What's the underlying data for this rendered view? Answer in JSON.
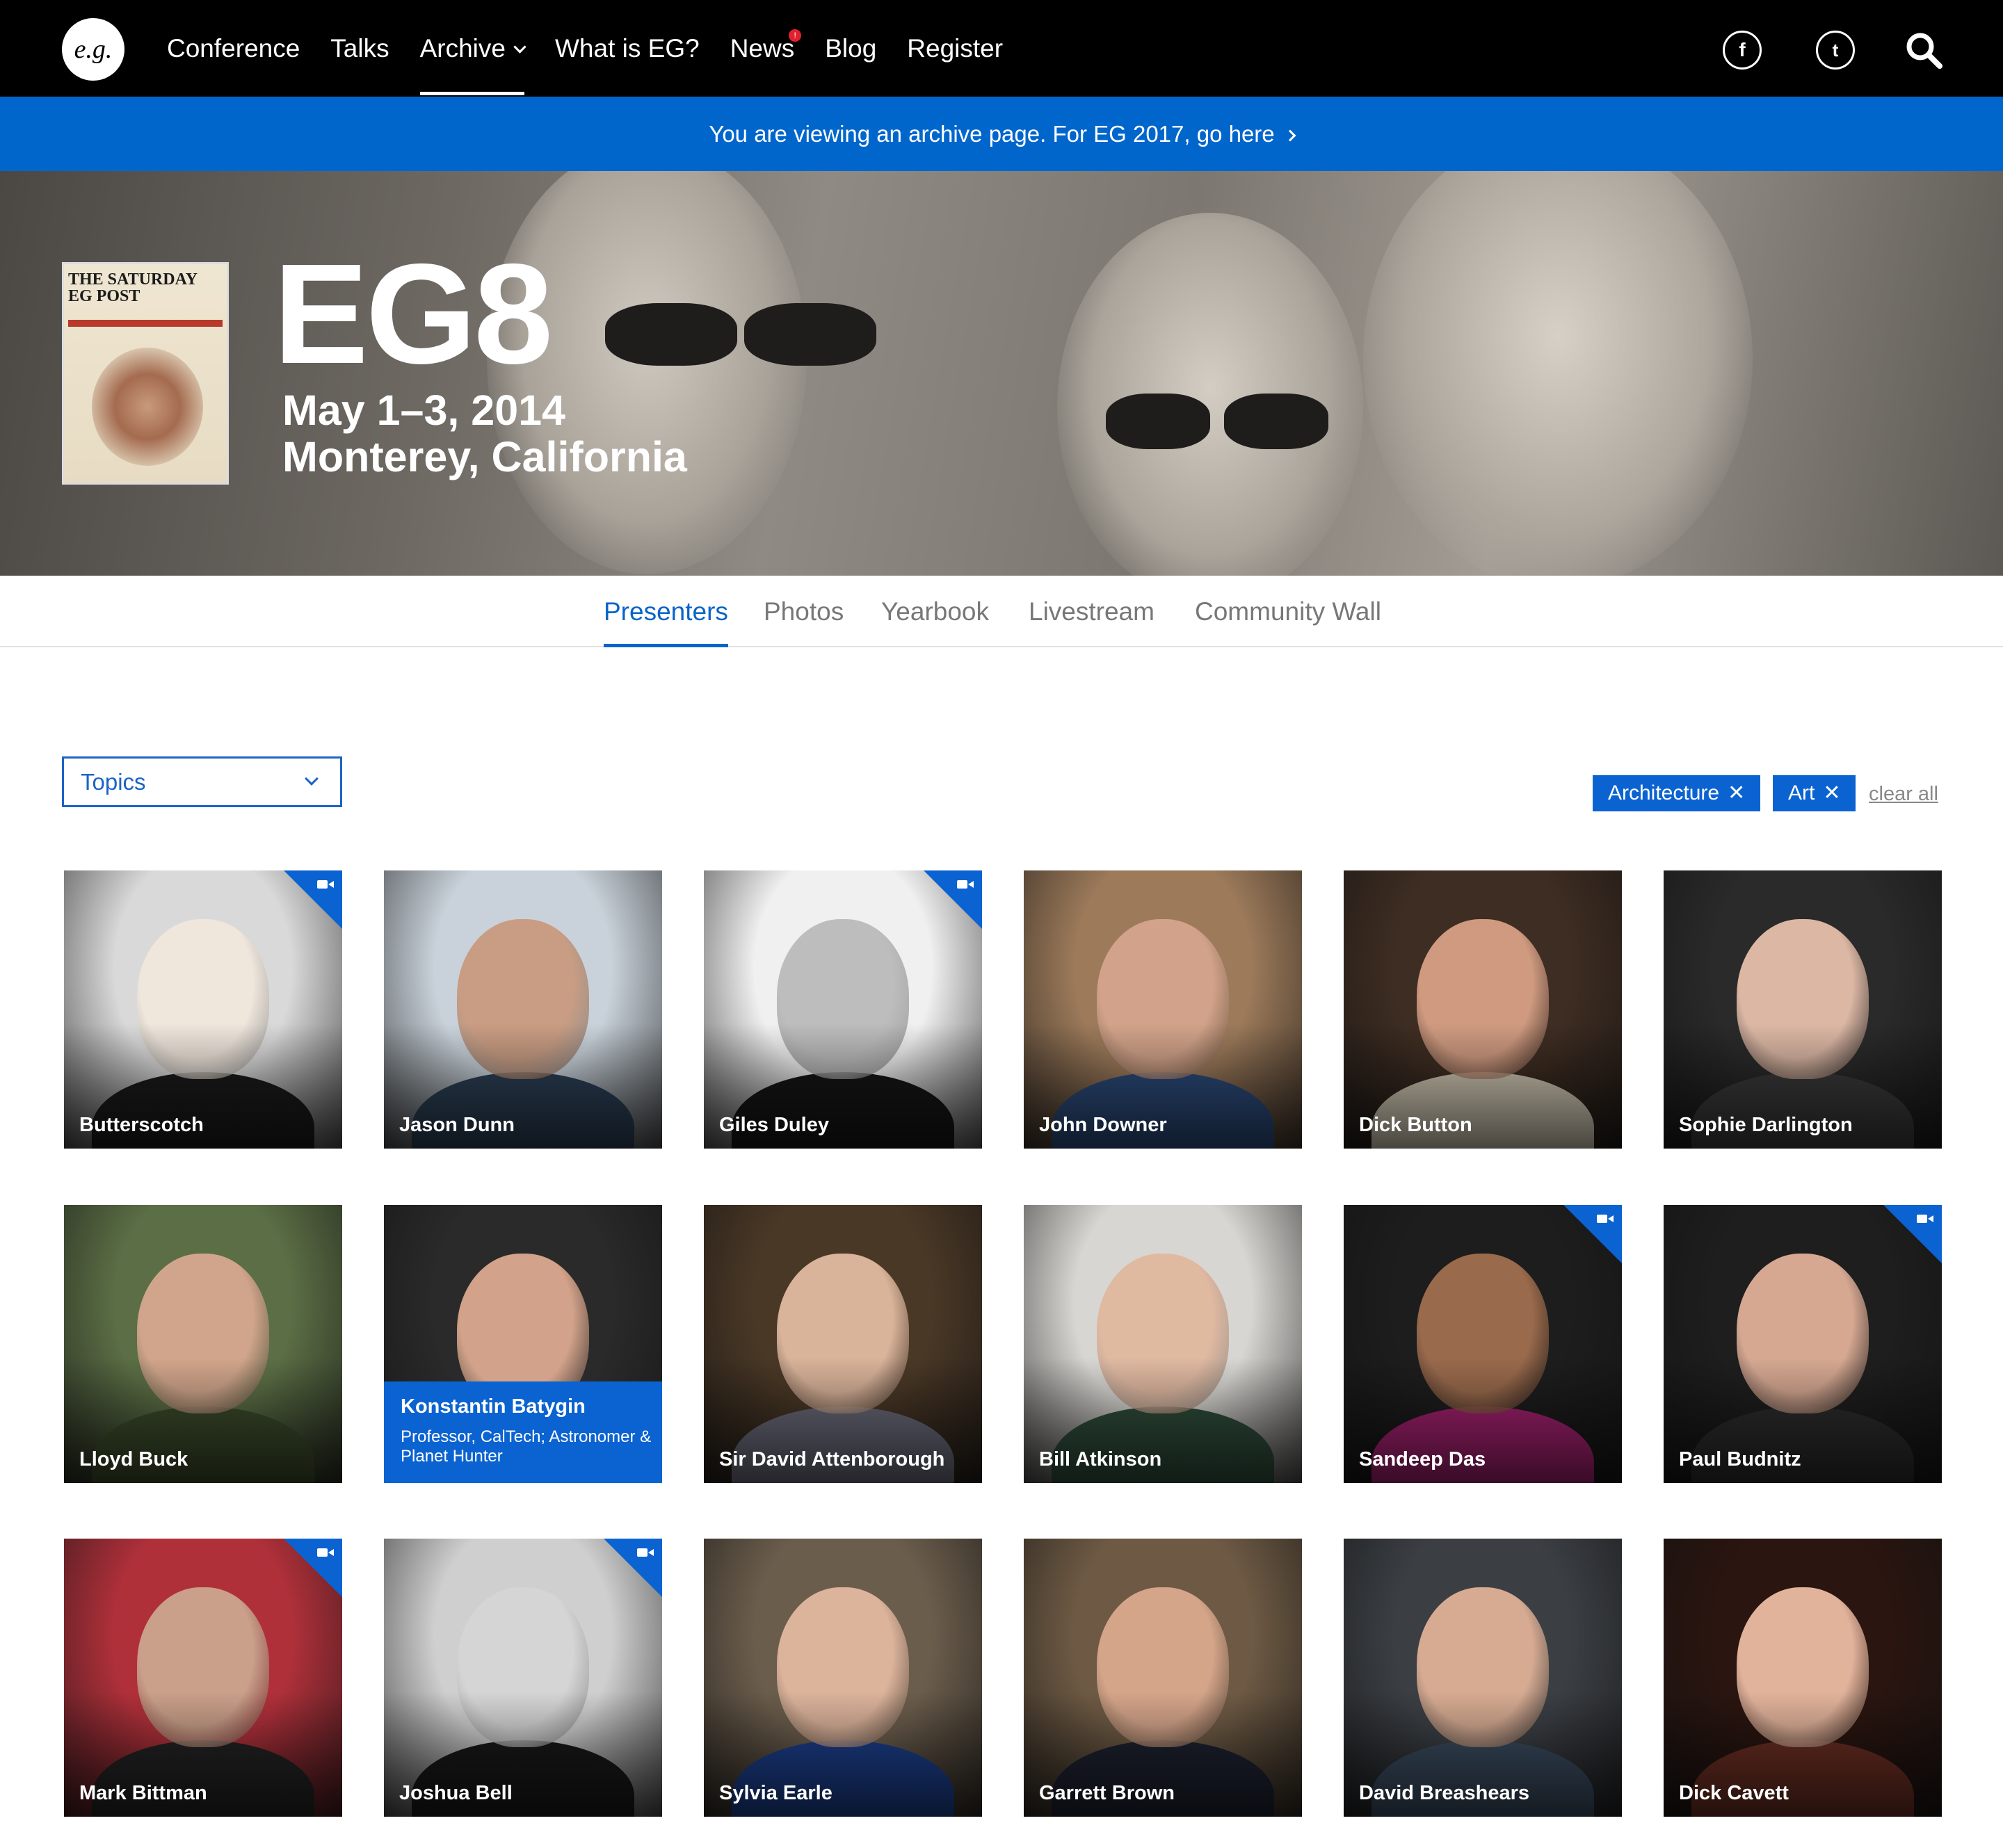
{
  "nav": {
    "logo_text": "e.g.",
    "links": [
      "Conference",
      "Talks",
      "Archive",
      "What is EG?",
      "News",
      "Blog",
      "Register"
    ],
    "active_link": "Archive",
    "news_badge": "!",
    "social": {
      "facebook": "f",
      "twitter": "t"
    },
    "icons": [
      "facebook-icon",
      "twitter-icon",
      "search-icon",
      "chevron-down-icon"
    ]
  },
  "banner": {
    "text": "You are viewing an archive page. For EG 2017, go here"
  },
  "hero": {
    "title": "EG8",
    "date": "May 1–3, 2014",
    "location": "Monterey, California",
    "cover_text": "THE SATURDAY EG POST"
  },
  "subtabs": [
    "Presenters",
    "Photos",
    "Yearbook",
    "Livestream",
    "Community Wall"
  ],
  "active_subtab": "Presenters",
  "filters": {
    "topics_label": "Topics",
    "chips": [
      "Architecture",
      "Art"
    ],
    "clear_label": "clear all"
  },
  "presenters": [
    {
      "name": "Butterscotch",
      "video": true,
      "tone": [
        "#d9d9d9",
        "#1b1b1b",
        "#efe6dc"
      ]
    },
    {
      "name": "Jason Dunn",
      "video": false,
      "tone": [
        "#c9d2da",
        "#2b3f55",
        "#c99d83"
      ]
    },
    {
      "name": "Giles Duley",
      "video": true,
      "tone": [
        "#f0f0f0",
        "#161616",
        "#bdbdbd"
      ]
    },
    {
      "name": "John Downer",
      "video": false,
      "tone": [
        "#9c7a5a",
        "#2c4b7a",
        "#d2a38a"
      ]
    },
    {
      "name": "Dick Button",
      "video": false,
      "tone": [
        "#3e2d22",
        "#cfc7b3",
        "#cf9a80"
      ]
    },
    {
      "name": "Sophie Darlington",
      "video": false,
      "tone": [
        "#2a2a2a",
        "#3a3a3a",
        "#dcb7a4"
      ]
    },
    {
      "name": "Lloyd Buck",
      "video": false,
      "tone": [
        "#5b6e45",
        "#3b4a2a",
        "#d1a58b"
      ]
    },
    {
      "name": "Konstantin Batygin",
      "video": false,
      "tone": [
        "#2a2a2a",
        "#3b3b3b",
        "#d2a28a"
      ],
      "role": "Professor, CalTech; Astronomer & Planet Hunter",
      "hovered": true
    },
    {
      "name": "Sir David Attenborough",
      "video": false,
      "tone": [
        "#4a3826",
        "#6a6a7a",
        "#d9b39a"
      ]
    },
    {
      "name": "Bill Atkinson",
      "video": false,
      "tone": [
        "#d8d6d2",
        "#2f4d3b",
        "#e0b9a1"
      ]
    },
    {
      "name": "Sandeep Das",
      "video": true,
      "tone": [
        "#1d1d1d",
        "#a3216f",
        "#9a6a4c"
      ]
    },
    {
      "name": "Paul Budnitz",
      "video": true,
      "tone": [
        "#1e1e1e",
        "#2c2c2c",
        "#d6a892"
      ]
    },
    {
      "name": "Mark Bittman",
      "video": true,
      "tone": [
        "#b0303a",
        "#232323",
        "#caa08a"
      ]
    },
    {
      "name": "Joshua Bell",
      "video": true,
      "tone": [
        "#cfcfcf",
        "#191919",
        "#d5d5d5"
      ]
    },
    {
      "name": "Sylvia Earle",
      "video": false,
      "tone": [
        "#6b5d4c",
        "#1c3f8c",
        "#dcb39b"
      ]
    },
    {
      "name": "Garrett Brown",
      "video": false,
      "tone": [
        "#6e5a44",
        "#1d2230",
        "#d5a58a"
      ]
    },
    {
      "name": "David Breashears",
      "video": false,
      "tone": [
        "#3b3f44",
        "#3a4b5f",
        "#d7ab92"
      ]
    },
    {
      "name": "Dick Cavett",
      "video": false,
      "tone": [
        "#2a1510",
        "#6a2e22",
        "#e2b39b"
      ]
    }
  ]
}
